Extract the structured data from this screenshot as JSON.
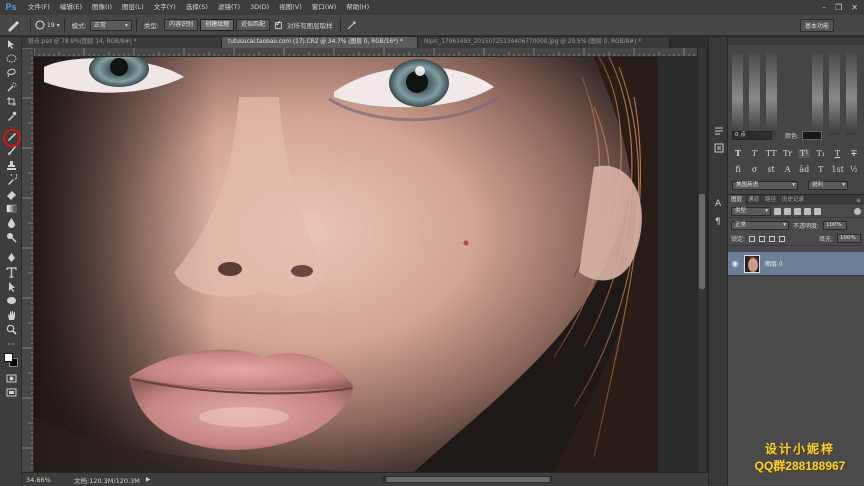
{
  "app": {
    "logo": "Ps"
  },
  "menu": [
    "文件(F)",
    "编辑(E)",
    "图像(I)",
    "图层(L)",
    "文字(Y)",
    "选择(S)",
    "滤镜(T)",
    "3D(D)",
    "视图(V)",
    "窗口(W)",
    "帮助(H)"
  ],
  "window_controls": {
    "minimize": "–",
    "restore": "❐",
    "close": "✕"
  },
  "options_bar": {
    "brush_size": "19",
    "mode_label": "模式:",
    "mode_value": "正常",
    "type_label": "类型:",
    "type_buttons": [
      "内容识别",
      "创建纹理",
      "近似匹配"
    ],
    "active_type_index": 1,
    "sample_all_layers": "对所有图层取样",
    "workspace": "基本功能"
  },
  "tabs": [
    {
      "label": "斑点.psd @ 78.9%(图层 14, RGB/8#) *",
      "active": false
    },
    {
      "label": "tutusucai.taobao.com (17).CR2 @ 34.7% (图层 0, RGB/16*) *",
      "active": true
    },
    {
      "label": "Nipic_17961493_20150725134406770000.jpg @ 29.5% (图层 0, RGB/8#) *",
      "active": false
    }
  ],
  "status": {
    "zoom": "34.66%",
    "doc_info": "文档:120.3M/120.3M",
    "arrow": "▶"
  },
  "character_panel": {
    "tracking_value": "0 点",
    "color_label": "颜色:",
    "color_value": "#1a1512",
    "language": "美国英语",
    "antialias": "锐利",
    "style_buttons": [
      "T",
      "T",
      "TT",
      "Tr",
      "T¹",
      "T₁",
      "T",
      "T"
    ],
    "style_buttons2": [
      "fi",
      "σ",
      "st",
      "A",
      "ād",
      "T",
      "1st",
      "½"
    ]
  },
  "layers_panel": {
    "tabs": [
      "图层",
      "通道",
      "路径",
      "历史记录"
    ],
    "active_tab_index": 0,
    "filter_label": "类型",
    "blend_mode": "正常",
    "opacity_label": "不透明度:",
    "opacity_value": "100%",
    "lock_label": "锁定:",
    "fill_label": "填充:",
    "fill_value": "100%",
    "layer_name": "图层 0"
  },
  "watermark": {
    "line1": "设计小妮梓",
    "line2": "QQ群288188967"
  }
}
